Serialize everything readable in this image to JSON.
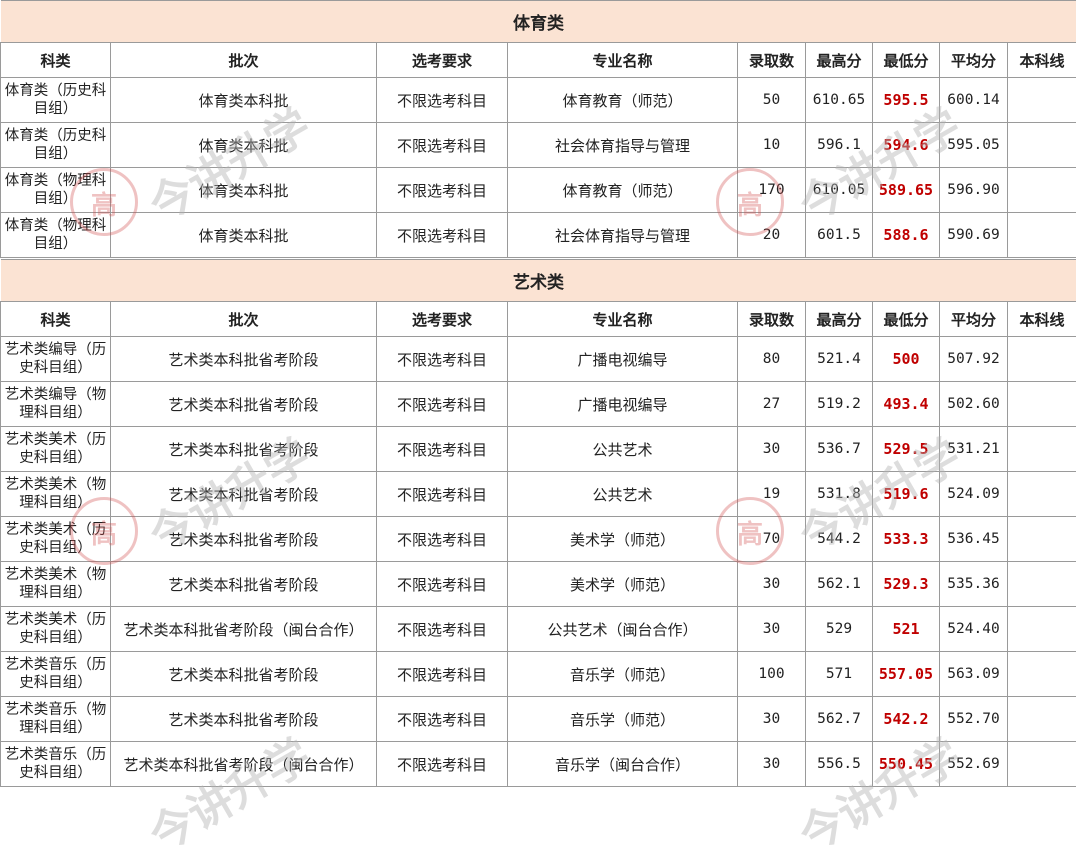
{
  "watermark": "今讲升学",
  "headers": [
    "科类",
    "批次",
    "选考要求",
    "专业名称",
    "录取数",
    "最高分",
    "最低分",
    "平均分",
    "本科线"
  ],
  "sections": [
    {
      "title": "体育类",
      "rows": [
        {
          "kelei": "体育类（历史科目组）",
          "pici": "体育类本科批",
          "xuankao": "不限选考科目",
          "zhuanye": "体育教育（师范）",
          "luqu": "50",
          "max": "610.65",
          "min": "595.5",
          "avg": "600.14",
          "line": ""
        },
        {
          "kelei": "体育类（历史科目组）",
          "pici": "体育类本科批",
          "xuankao": "不限选考科目",
          "zhuanye": "社会体育指导与管理",
          "luqu": "10",
          "max": "596.1",
          "min": "594.6",
          "avg": "595.05",
          "line": ""
        },
        {
          "kelei": "体育类（物理科目组）",
          "pici": "体育类本科批",
          "xuankao": "不限选考科目",
          "zhuanye": "体育教育（师范）",
          "luqu": "170",
          "max": "610.05",
          "min": "589.65",
          "avg": "596.90",
          "line": ""
        },
        {
          "kelei": "体育类（物理科目组）",
          "pici": "体育类本科批",
          "xuankao": "不限选考科目",
          "zhuanye": "社会体育指导与管理",
          "luqu": "20",
          "max": "601.5",
          "min": "588.6",
          "avg": "590.69",
          "line": ""
        }
      ]
    },
    {
      "title": "艺术类",
      "rows": [
        {
          "kelei": "艺术类编导（历史科目组）",
          "pici": "艺术类本科批省考阶段",
          "xuankao": "不限选考科目",
          "zhuanye": "广播电视编导",
          "luqu": "80",
          "max": "521.4",
          "min": "500",
          "avg": "507.92",
          "line": ""
        },
        {
          "kelei": "艺术类编导（物理科目组）",
          "pici": "艺术类本科批省考阶段",
          "xuankao": "不限选考科目",
          "zhuanye": "广播电视编导",
          "luqu": "27",
          "max": "519.2",
          "min": "493.4",
          "avg": "502.60",
          "line": ""
        },
        {
          "kelei": "艺术类美术（历史科目组）",
          "pici": "艺术类本科批省考阶段",
          "xuankao": "不限选考科目",
          "zhuanye": "公共艺术",
          "luqu": "30",
          "max": "536.7",
          "min": "529.5",
          "avg": "531.21",
          "line": ""
        },
        {
          "kelei": "艺术类美术（物理科目组）",
          "pici": "艺术类本科批省考阶段",
          "xuankao": "不限选考科目",
          "zhuanye": "公共艺术",
          "luqu": "19",
          "max": "531.8",
          "min": "519.6",
          "avg": "524.09",
          "line": ""
        },
        {
          "kelei": "艺术类美术（历史科目组）",
          "pici": "艺术类本科批省考阶段",
          "xuankao": "不限选考科目",
          "zhuanye": "美术学（师范）",
          "luqu": "70",
          "max": "544.2",
          "min": "533.3",
          "avg": "536.45",
          "line": ""
        },
        {
          "kelei": "艺术类美术（物理科目组）",
          "pici": "艺术类本科批省考阶段",
          "xuankao": "不限选考科目",
          "zhuanye": "美术学（师范）",
          "luqu": "30",
          "max": "562.1",
          "min": "529.3",
          "avg": "535.36",
          "line": ""
        },
        {
          "kelei": "艺术类美术（历史科目组）",
          "pici": "艺术类本科批省考阶段（闽台合作）",
          "xuankao": "不限选考科目",
          "zhuanye": "公共艺术（闽台合作）",
          "luqu": "30",
          "max": "529",
          "min": "521",
          "avg": "524.40",
          "line": ""
        },
        {
          "kelei": "艺术类音乐（历史科目组）",
          "pici": "艺术类本科批省考阶段",
          "xuankao": "不限选考科目",
          "zhuanye": "音乐学（师范）",
          "luqu": "100",
          "max": "571",
          "min": "557.05",
          "avg": "563.09",
          "line": ""
        },
        {
          "kelei": "艺术类音乐（物理科目组）",
          "pici": "艺术类本科批省考阶段",
          "xuankao": "不限选考科目",
          "zhuanye": "音乐学（师范）",
          "luqu": "30",
          "max": "562.7",
          "min": "542.2",
          "avg": "552.70",
          "line": ""
        },
        {
          "kelei": "艺术类音乐（历史科目组）",
          "pici": "艺术类本科批省考阶段（闽台合作）",
          "xuankao": "不限选考科目",
          "zhuanye": "音乐学（闽台合作）",
          "luqu": "30",
          "max": "556.5",
          "min": "550.45",
          "avg": "552.69",
          "line": ""
        }
      ]
    }
  ]
}
